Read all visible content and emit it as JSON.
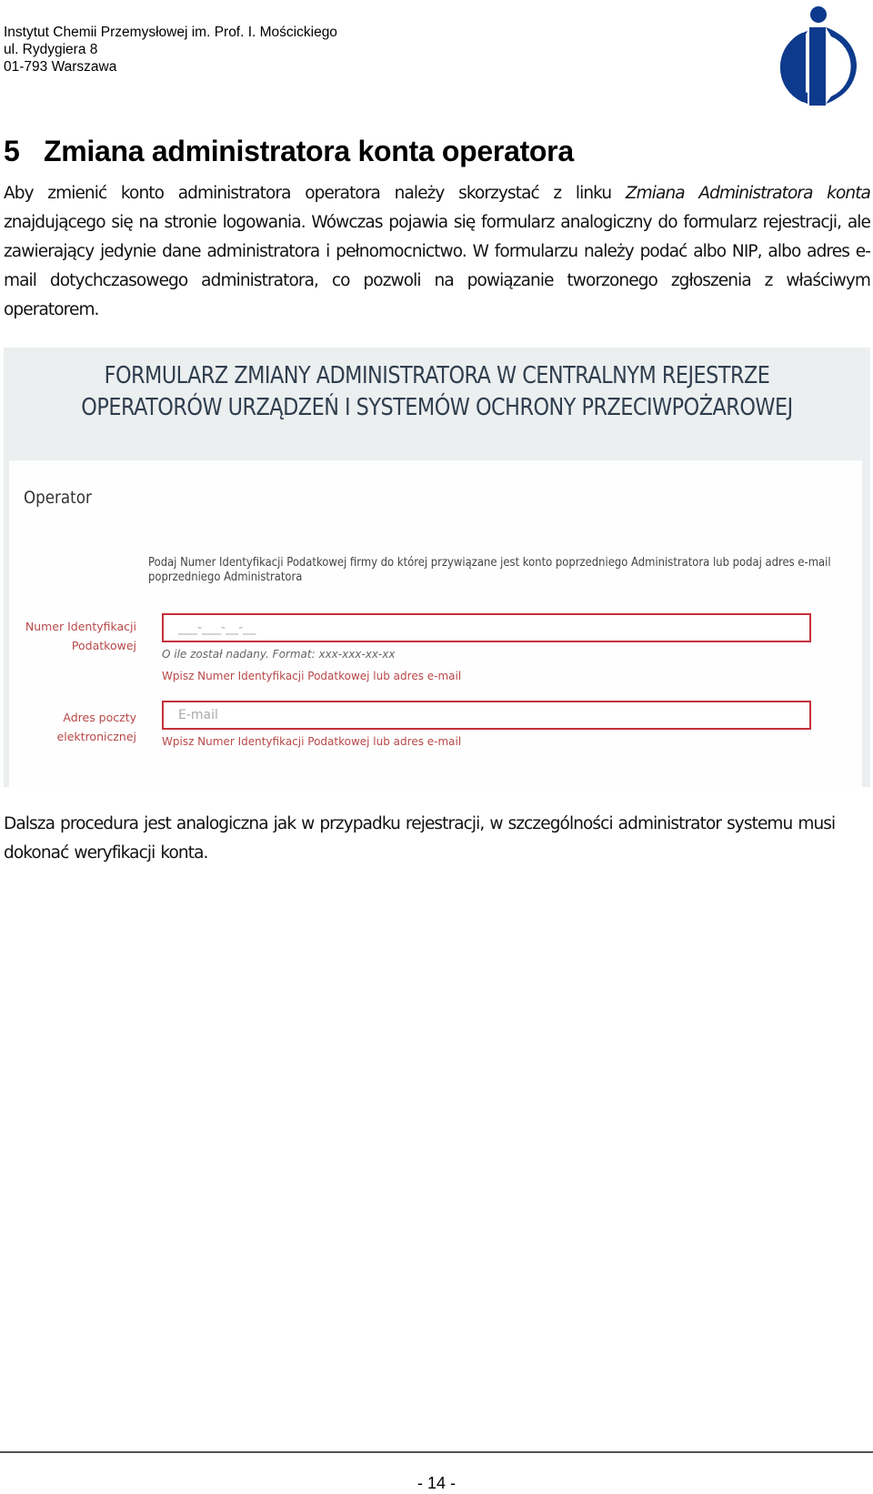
{
  "header": {
    "address_lines": [
      "Instytut Chemii Przemysłowej im. Prof. I. Mościckiego",
      "ul. Rydygiera 8",
      "01-793 Warszawa"
    ],
    "logo": "ichp-logo-icon",
    "brand_color": "#0d3a8c"
  },
  "section": {
    "number": "5",
    "title": "Zmiana administratora konta operatora"
  },
  "paragraph1": {
    "before_link": "Aby zmienić konto administratora operatora należy skorzystać z linku ",
    "link_text": "Zmiana Administratora konta",
    "after_link": " znajdującego się na stronie logowania. Wówczas pojawia się formularz analogiczny do formularz rejestracji, ale zawierający jedynie dane administratora i pełnomocnictwo. W formularzu należy podać albo NIP, albo adres e-mail dotychczasowego administratora, co pozwoli na powiązanie tworzonego zgłoszenia z właściwym operatorem."
  },
  "form_screenshot": {
    "title": "FORMULARZ ZMIANY ADMINISTRATORA W CENTRALNYM REJESTRZE OPERATORÓW URZĄDZEŃ I SYSTEMÓW OCHRONY PRZECIWPOŻAROWEJ",
    "section_heading": "Operator",
    "instruction": "Podaj Numer Identyfikacji Podatkowej firmy do której przywiązane jest konto poprzedniego Administratora lub podaj adres e-mail poprzedniego Administratora",
    "nip_field": {
      "label_line1": "Numer Identyfikacji",
      "label_line2": "Podatkowej",
      "placeholder": "___-___-__-__",
      "value": "",
      "hint": "O ile został nadany. Format: xxx-xxx-xx-xx",
      "error": "Wpisz Numer Identyfikacji Podatkowej lub adres e-mail"
    },
    "email_field": {
      "label_line1": "Adres poczty",
      "label_line2": "elektronicznej",
      "placeholder": "E-mail",
      "value": "",
      "error": "Wpisz Numer Identyfikacji Podatkowej lub adres e-mail"
    },
    "error_color": "#c4303a",
    "header_bg": "#eceff0"
  },
  "paragraph2": "Dalsza procedura jest analogiczna jak w przypadku rejestracji, w szczególności administrator systemu musi dokonać weryfikacji konta.",
  "footer": {
    "page_number": "- 14 -"
  }
}
